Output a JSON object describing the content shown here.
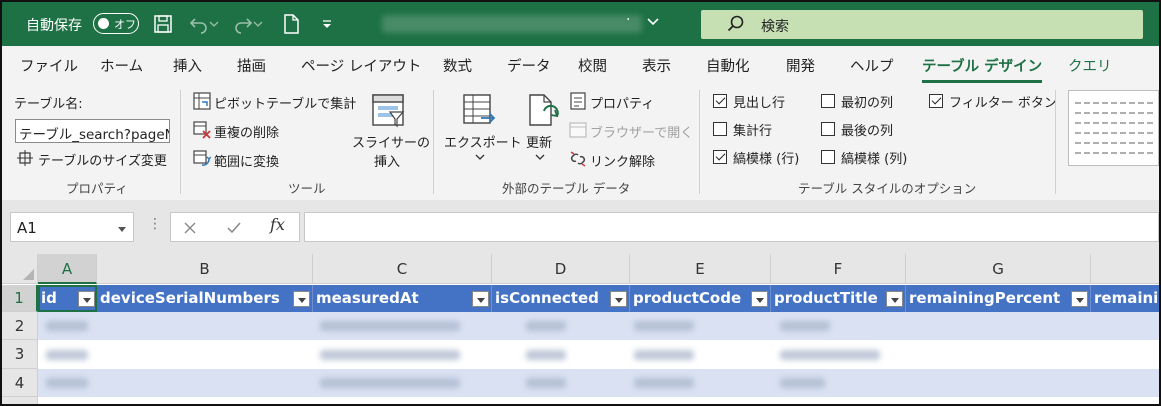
{
  "titlebar": {
    "autosave_label": "自動保存",
    "autosave_state": "オフ",
    "search_label": "検索",
    "accent_color": "#1e7145"
  },
  "tabs": [
    {
      "label": "ファイル"
    },
    {
      "label": "ホーム"
    },
    {
      "label": "挿入"
    },
    {
      "label": "描画"
    },
    {
      "label": "ページ レイアウト"
    },
    {
      "label": "数式"
    },
    {
      "label": "データ"
    },
    {
      "label": "校閲"
    },
    {
      "label": "表示"
    },
    {
      "label": "自動化"
    },
    {
      "label": "開発"
    },
    {
      "label": "ヘルプ"
    },
    {
      "label": "テーブル デザイン",
      "active": true
    },
    {
      "label": "クエリ"
    }
  ],
  "ribbon": {
    "properties": {
      "table_name_label": "テーブル名:",
      "table_name_value": "テーブル_search?pageNo",
      "resize_label": "テーブルのサイズ変更",
      "group_label": "プロパティ"
    },
    "tools": {
      "pivot_label": "ピボットテーブルで集計",
      "remove_dup_label": "重複の削除",
      "convert_label": "範囲に変換",
      "slicer_line1": "スライサーの",
      "slicer_line2": "挿入",
      "group_label": "ツール"
    },
    "external": {
      "export_label": "エクスポート",
      "refresh_label": "更新",
      "properties_label": "プロパティ",
      "browser_label": "ブラウザーで開く",
      "unlink_label": "リンク解除",
      "group_label": "外部のテーブル データ"
    },
    "style_options": {
      "header_row": {
        "label": "見出し行",
        "checked": true
      },
      "total_row": {
        "label": "集計行",
        "checked": false
      },
      "banded_rows": {
        "label": "縞模様 (行)",
        "checked": true
      },
      "first_column": {
        "label": "最初の列",
        "checked": false
      },
      "last_column": {
        "label": "最後の列",
        "checked": false
      },
      "banded_columns": {
        "label": "縞模様 (列)",
        "checked": false
      },
      "filter_button": {
        "label": "フィルター ボタン",
        "checked": true
      },
      "group_label": "テーブル スタイルのオプション"
    }
  },
  "formula_bar": {
    "cell_ref": "A1",
    "fx": "fx",
    "formula": ""
  },
  "sheet": {
    "columns": [
      "A",
      "B",
      "C",
      "D",
      "E",
      "F",
      "G"
    ],
    "rows": [
      "1",
      "2",
      "3",
      "4"
    ],
    "headers": [
      "id",
      "deviceSerialNumbers",
      "measuredAt",
      "isConnected",
      "productCode",
      "productTitle",
      "remainingPercent",
      "remainin"
    ],
    "header_color": "#4472c4",
    "band_color": "#d9e1f2"
  }
}
